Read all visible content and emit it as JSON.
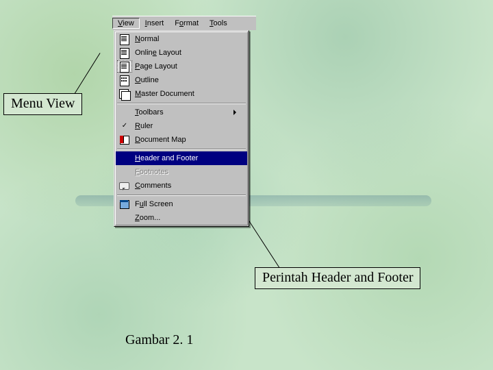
{
  "menubar": {
    "items": [
      {
        "label": "View",
        "accel": "V",
        "pressed": true
      },
      {
        "label": "Insert",
        "accel": "I"
      },
      {
        "label": "Format",
        "accel": "o"
      },
      {
        "label": "Tools",
        "accel": "T"
      }
    ]
  },
  "viewMenu": {
    "groups": [
      [
        {
          "label": "Normal",
          "accel": "N",
          "icon": "doc"
        },
        {
          "label": "Online Layout",
          "accel": "e",
          "icon": "doc"
        },
        {
          "label": "Page Layout",
          "accel": "P",
          "icon": "doc",
          "selectedIcon": true
        },
        {
          "label": "Outline",
          "accel": "O",
          "icon": "outline"
        },
        {
          "label": "Master Document",
          "accel": "M",
          "icon": "master"
        }
      ],
      [
        {
          "label": "Toolbars",
          "accel": "T",
          "submenu": true
        },
        {
          "label": "Ruler",
          "accel": "R",
          "checked": true
        },
        {
          "label": "Document Map",
          "accel": "D",
          "icon": "docmap"
        }
      ],
      [
        {
          "label": "Header and Footer",
          "accel": "H",
          "highlight": true
        },
        {
          "label": "Footnotes",
          "accel": "F",
          "disabled": true
        },
        {
          "label": "Comments",
          "accel": "C",
          "icon": "comments"
        }
      ],
      [
        {
          "label": "Full Screen",
          "accel": "u",
          "icon": "fullscreen"
        },
        {
          "label": "Zoom...",
          "accel": "Z"
        }
      ]
    ]
  },
  "callouts": {
    "left": "Menu View",
    "right": "Perintah Header and Footer"
  },
  "caption": "Gambar 2. 1"
}
